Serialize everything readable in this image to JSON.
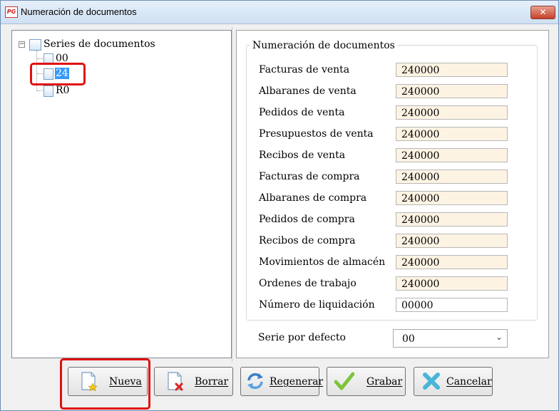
{
  "window": {
    "title": "Numeración de documentos",
    "close_glyph": "✕",
    "icon_text": "PG"
  },
  "tree": {
    "root_label": "Series de documentos",
    "expander_glyph": "−",
    "items": [
      {
        "label": "00",
        "selected": false
      },
      {
        "label": "24",
        "selected": true
      },
      {
        "label": "R0",
        "selected": false
      }
    ]
  },
  "group": {
    "title": "Numeración de documentos",
    "rows": [
      {
        "label": "Facturas de venta",
        "value": "240000"
      },
      {
        "label": "Albaranes de venta",
        "value": "240000"
      },
      {
        "label": "Pedidos de venta",
        "value": "240000"
      },
      {
        "label": "Presupuestos de venta",
        "value": "240000"
      },
      {
        "label": "Recibos de venta",
        "value": "240000"
      },
      {
        "label": "Facturas de compra",
        "value": "240000"
      },
      {
        "label": "Albaranes de compra",
        "value": "240000"
      },
      {
        "label": "Pedidos de compra",
        "value": "240000"
      },
      {
        "label": "Recibos de compra",
        "value": "240000"
      },
      {
        "label": "Movimientos de almacén",
        "value": "240000"
      },
      {
        "label": "Ordenes de trabajo",
        "value": "240000"
      },
      {
        "label": "Número de liquidación",
        "value": "00000"
      }
    ]
  },
  "default_serie": {
    "label": "Serie por defecto",
    "value": "00"
  },
  "buttons": [
    {
      "label": "Nueva",
      "icon": "new-document-icon"
    },
    {
      "label": "Borrar",
      "icon": "delete-document-icon"
    },
    {
      "label": "Regenerar",
      "icon": "refresh-icon"
    },
    {
      "label": "Grabar",
      "icon": "checkmark-icon"
    },
    {
      "label": "Cancelar",
      "icon": "cancel-x-icon"
    }
  ],
  "colors": {
    "highlight": "#e01010",
    "selection": "#3399ff",
    "input_bg": "#fdf3e3"
  }
}
